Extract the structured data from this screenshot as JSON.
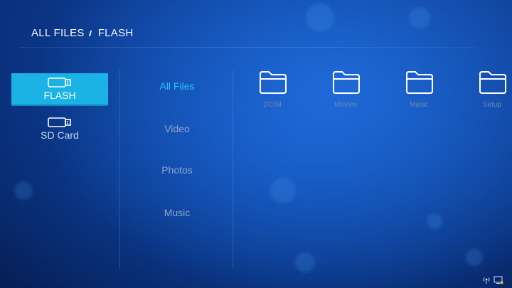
{
  "breadcrumb": {
    "root": "ALL FILES",
    "current": "FLASH"
  },
  "devices": [
    {
      "label": "FLASH",
      "active": true
    },
    {
      "label": "SD Card",
      "active": false
    }
  ],
  "categories": [
    {
      "label": "All Files",
      "active": true
    },
    {
      "label": "Video",
      "active": false
    },
    {
      "label": "Photos",
      "active": false
    },
    {
      "label": "Music",
      "active": false
    }
  ],
  "files": [
    {
      "name": "DCIM",
      "icon": "folder-icon"
    },
    {
      "name": "Movies",
      "icon": "folder-icon"
    },
    {
      "name": "Music",
      "icon": "folder-icon"
    },
    {
      "name": "Setup",
      "icon": "folder-icon"
    }
  ],
  "status_icons": [
    "network-icon",
    "screen-record-icon"
  ],
  "colors": {
    "accent": "#1bb2e6",
    "active_text": "#1fc7ff",
    "background": "#0a2f7a"
  }
}
